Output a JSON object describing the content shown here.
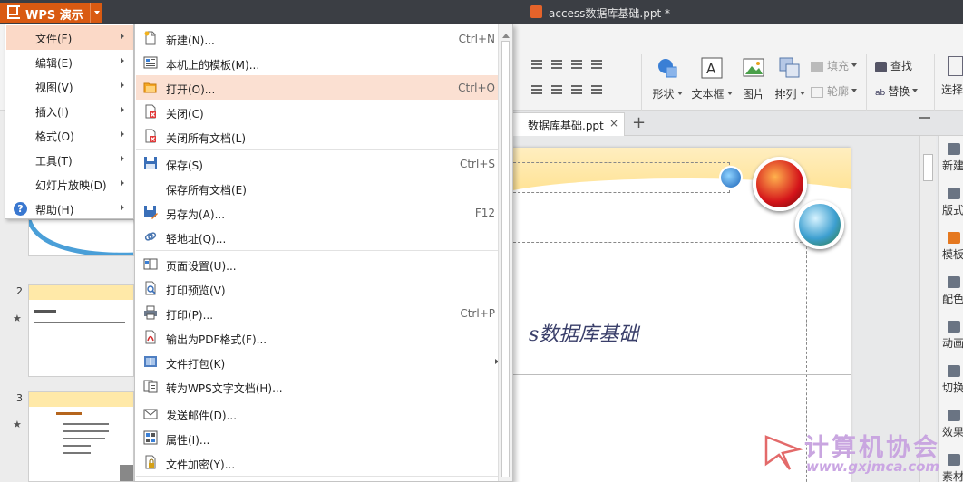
{
  "titlebar": {
    "app_button": "WPS 演示",
    "doc_title": "access数据库基础.ppt *"
  },
  "ribbon": {
    "find": "查找",
    "replace": "替换",
    "select": "选择",
    "fill": "填充",
    "outline": "轮廓",
    "shape": "形状",
    "textbox": "文本框",
    "picture": "图片",
    "arrange": "排列"
  },
  "tabstrip": {
    "tab_label": "数据库基础.ppt",
    "close_glyph": "×",
    "add_glyph": "+"
  },
  "slide": {
    "title": "s数据库基础"
  },
  "right_sidebar": {
    "items": [
      "新建",
      "版式",
      "模板",
      "配色",
      "动画",
      "切换",
      "效果",
      "素材"
    ]
  },
  "thumbnails": {
    "numbers": [
      "2",
      "3"
    ],
    "star": "★"
  },
  "main_menu": {
    "items": [
      {
        "label": "文件(F)"
      },
      {
        "label": "编辑(E)"
      },
      {
        "label": "视图(V)"
      },
      {
        "label": "插入(I)"
      },
      {
        "label": "格式(O)"
      },
      {
        "label": "工具(T)"
      },
      {
        "label": "幻灯片放映(D)"
      },
      {
        "label": "帮助(H)"
      }
    ],
    "help_glyph": "?"
  },
  "file_menu": {
    "items": [
      {
        "label": "新建(N)...",
        "shortcut": "Ctrl+N"
      },
      {
        "label": "本机上的模板(M)...",
        "shortcut": ""
      },
      {
        "label": "打开(O)...",
        "shortcut": "Ctrl+O"
      },
      {
        "label": "关闭(C)",
        "shortcut": ""
      },
      {
        "label": "关闭所有文档(L)",
        "shortcut": ""
      },
      {
        "label": "保存(S)",
        "shortcut": "Ctrl+S"
      },
      {
        "label": "保存所有文档(E)",
        "shortcut": ""
      },
      {
        "label": "另存为(A)...",
        "shortcut": "F12"
      },
      {
        "label": "轻地址(Q)...",
        "shortcut": ""
      },
      {
        "label": "页面设置(U)...",
        "shortcut": ""
      },
      {
        "label": "打印预览(V)",
        "shortcut": ""
      },
      {
        "label": "打印(P)...",
        "shortcut": "Ctrl+P"
      },
      {
        "label": "输出为PDF格式(F)...",
        "shortcut": ""
      },
      {
        "label": "文件打包(K)",
        "shortcut": ""
      },
      {
        "label": "转为WPS文字文档(H)...",
        "shortcut": ""
      },
      {
        "label": "发送邮件(D)...",
        "shortcut": ""
      },
      {
        "label": "属性(I)...",
        "shortcut": ""
      },
      {
        "label": "文件加密(Y)...",
        "shortcut": ""
      }
    ]
  },
  "watermark": {
    "text": "计算机协会",
    "url": "www.gxjmca.com"
  },
  "colors": {
    "accent": "#d95a12",
    "menu_highlight": "#fbd9c7",
    "titlebar": "#3b3e44"
  }
}
